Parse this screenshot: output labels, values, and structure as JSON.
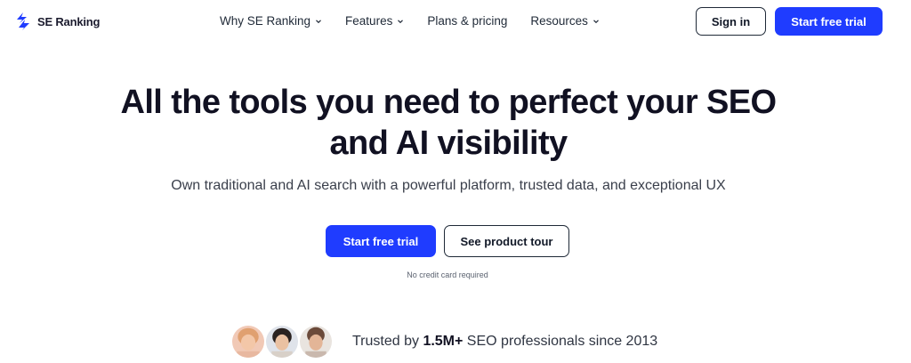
{
  "brand": {
    "name": "SE Ranking",
    "accent": "#1f3cff"
  },
  "nav": {
    "items": [
      {
        "label": "Why SE Ranking",
        "has_dropdown": true
      },
      {
        "label": "Features",
        "has_dropdown": true
      },
      {
        "label": "Plans & pricing",
        "has_dropdown": false
      },
      {
        "label": "Resources",
        "has_dropdown": true
      }
    ],
    "sign_in": "Sign in",
    "start_trial": "Start free trial"
  },
  "hero": {
    "title_line1": "All the tools you need to perfect your SEO",
    "title_line2": "and AI visibility",
    "subtitle": "Own traditional and AI search with a powerful platform, trusted data, and exceptional UX",
    "primary_cta": "Start free trial",
    "secondary_cta": "See product tour",
    "note": "No credit card required"
  },
  "trust": {
    "prefix": "Trusted by ",
    "count": "1.5M+",
    "suffix": " SEO professionals since 2013",
    "avatars": [
      "avatar-1",
      "avatar-2",
      "avatar-3"
    ]
  }
}
